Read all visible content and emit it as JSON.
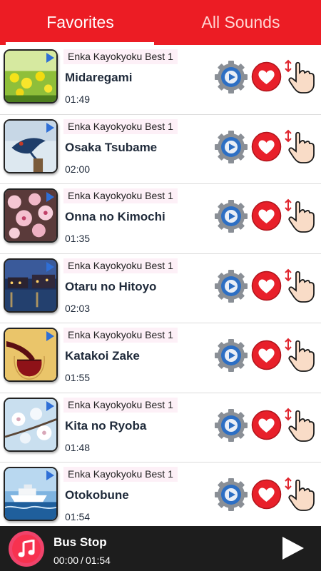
{
  "tabs": [
    {
      "label": "Favorites",
      "active": true
    },
    {
      "label": "All Sounds",
      "active": false
    }
  ],
  "colors": {
    "accent": "#ec1c24",
    "heart": "#e8202a",
    "player_bg": "#1d1d1d"
  },
  "songs": [
    {
      "album": "Enka Kayokyoku Best 1",
      "title": "Midaregami",
      "duration": "01:49",
      "thumb": "yellow-flowers-image"
    },
    {
      "album": "Enka Kayokyoku Best 1",
      "title": "Osaka Tsubame",
      "duration": "02:00",
      "thumb": "swallow-bird-image"
    },
    {
      "album": "Enka Kayokyoku Best 1",
      "title": "Onna no Kimochi",
      "duration": "01:35",
      "thumb": "pink-blossom-image"
    },
    {
      "album": "Enka Kayokyoku Best 1",
      "title": "Otaru no Hitoyo",
      "duration": "02:03",
      "thumb": "night-harbor-image"
    },
    {
      "album": "Enka Kayokyoku Best 1",
      "title": "Katakoi Zake",
      "duration": "01:55",
      "thumb": "red-wine-image"
    },
    {
      "album": "Enka Kayokyoku Best 1",
      "title": "Kita no Ryoba",
      "duration": "01:48",
      "thumb": "white-blossom-image"
    },
    {
      "album": "Enka Kayokyoku Best 1",
      "title": "Otokobune",
      "duration": "01:54",
      "thumb": "boat-sea-image"
    }
  ],
  "row_icons": [
    "gear-play-icon",
    "heart-icon",
    "drag-hand-icon"
  ],
  "player": {
    "title": "Bus Stop",
    "elapsed": "00:00",
    "separator": "/",
    "total": "01:54",
    "icon": "music-note-icon",
    "button_icon": "play-icon"
  }
}
